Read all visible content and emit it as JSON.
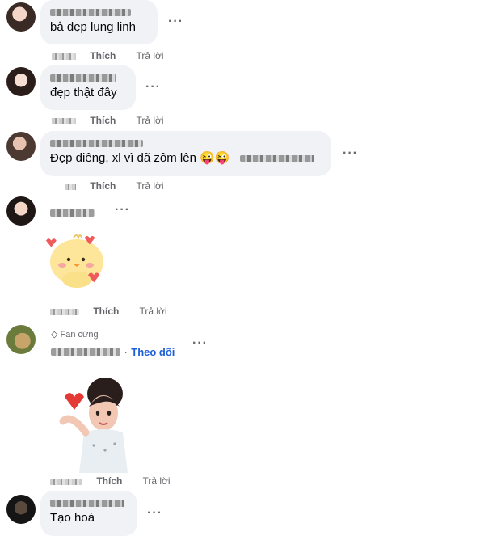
{
  "comments": [
    {
      "text": "bả đẹp lung linh",
      "like": "Thích",
      "reply": "Trả lời"
    },
    {
      "text": "đẹp thật đây",
      "like": "Thích",
      "reply": "Trả lời"
    },
    {
      "text": "Đẹp điêng, xl vì đã zôm lên 😜😜",
      "like": "Thích",
      "reply": "Trả lời"
    },
    {
      "text": "",
      "like": "Thích",
      "reply": "Trả lời"
    },
    {
      "badge": "Fan cứng",
      "follow": "Theo dõi",
      "like": "Thích",
      "reply": "Trả lời"
    },
    {
      "text": "Tạo hoá"
    }
  ],
  "colors": {
    "bubble": "#f0f2f5",
    "muted": "#65676b",
    "link": "#1d5fd6"
  },
  "icons": {
    "more": "more-options-icon",
    "badge": "diamond-icon"
  }
}
